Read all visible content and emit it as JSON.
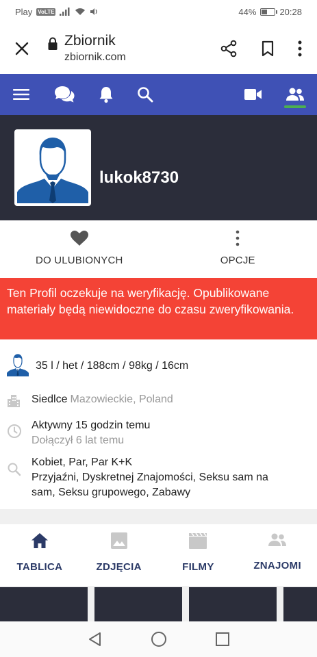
{
  "status_bar": {
    "carrier": "Play",
    "volte": "VoLTE",
    "battery_percent": "44%",
    "battery_level": 0.44,
    "time": "20:28"
  },
  "browser": {
    "title": "Zbiornik",
    "url": "zbiornik.com",
    "icons": [
      "close-icon",
      "lock-icon",
      "share-icon",
      "bookmark-icon",
      "more-vert-icon"
    ]
  },
  "nav": {
    "icons": [
      "menu-icon",
      "chat-icon",
      "bell-icon",
      "search-icon",
      "video-icon",
      "friends-icon"
    ],
    "active": "friends-icon",
    "bg_color": "#3f51b5",
    "active_color": "#4caf50"
  },
  "profile": {
    "username": "lukok8730"
  },
  "actions": {
    "favorite_label": "DO ULUBIONYCH",
    "options_label": "OPCJE"
  },
  "warning": {
    "text": "Ten Profil oczekuje na weryfikację. Opublikowane materiały będą niewidoczne do czasu zweryfikowania.",
    "color": "#f44336"
  },
  "info": {
    "stats": "35 l / het / 188cm / 98kg / 16cm",
    "city": "Siedlce",
    "region": "Mazowieckie, Poland",
    "active": "Aktywny 15 godzin temu",
    "joined": "Dołączył 6 lat temu",
    "seeking_who": "Kobiet, Par, Par K+K",
    "seeking_what": "Przyjaźni, Dyskretnej Znajomości, Seksu sam na sam, Seksu grupowego, Zabawy"
  },
  "tabs": [
    {
      "label": "TABLICA",
      "icon": "home-icon",
      "active": true
    },
    {
      "label": "ZDJĘCIA",
      "icon": "image-icon",
      "active": false
    },
    {
      "label": "FILMY",
      "icon": "film-icon",
      "active": false
    },
    {
      "label": "ZNAJOMI",
      "icon": "people-icon",
      "active": false
    }
  ],
  "android_nav": [
    "back-icon",
    "home-circle-icon",
    "recents-icon"
  ]
}
